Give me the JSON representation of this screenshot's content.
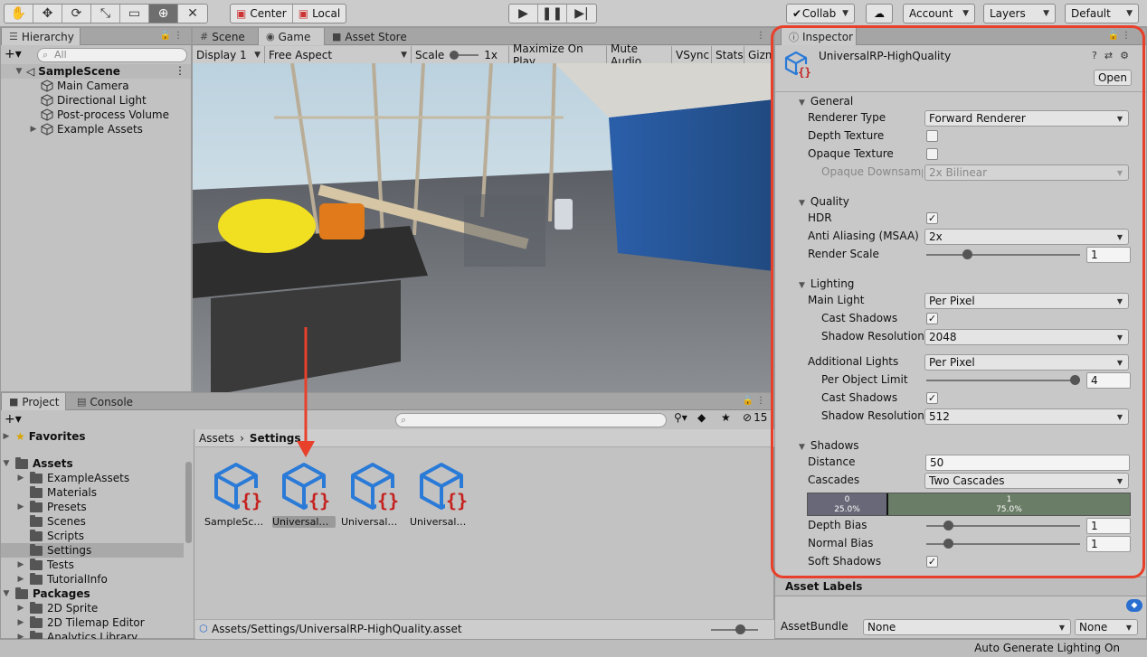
{
  "toolbar": {
    "tools": [
      "hand-icon",
      "move-icon",
      "rotate-icon",
      "scale-icon",
      "rect-icon",
      "transform-icon",
      "custom-tool-icon"
    ],
    "pivot_mode": "Center",
    "pivot_rotation": "Local",
    "collab": "Collab",
    "account": "Account",
    "layers": "Layers",
    "layout": "Default"
  },
  "hierarchy": {
    "tab_label": "Hierarchy",
    "search_placeholder": "All",
    "scene": "SampleScene",
    "items": [
      "Main Camera",
      "Directional Light",
      "Post-process Volume",
      "Example Assets"
    ]
  },
  "center_tabs": {
    "scene": "Scene",
    "game": "Game",
    "asset_store": "Asset Store"
  },
  "game_toolbar": {
    "display": "Display 1",
    "aspect": "Free Aspect",
    "scale_label": "Scale",
    "scale_value": "1x",
    "maximize": "Maximize On Play",
    "mute": "Mute Audio",
    "vsync": "VSync",
    "stats": "Stats",
    "gizmos": "Gizmos"
  },
  "project": {
    "tab_label": "Project",
    "console_label": "Console",
    "hidden_count": "15",
    "favorites": "Favorites",
    "assets_root": "Assets",
    "asset_folders": [
      "ExampleAssets",
      "Materials",
      "Presets",
      "Scenes",
      "Scripts",
      "Settings",
      "Tests",
      "TutorialInfo"
    ],
    "packages_root": "Packages",
    "package_folders": [
      "2D Sprite",
      "2D Tilemap Editor",
      "Analytics Library"
    ],
    "breadcrumb": [
      "Assets",
      "Settings"
    ],
    "asset_files": [
      "SampleSce...",
      "UniversalRP...",
      "UniversalRP...",
      "UniversalRP..."
    ],
    "status_path": "Assets/Settings/UniversalRP-HighQuality.asset"
  },
  "inspector": {
    "tab_label": "Inspector",
    "asset_name": "UniversalRP-HighQuality",
    "open_button": "Open",
    "general": {
      "title": "General",
      "renderer_type_label": "Renderer Type",
      "renderer_type": "Forward Renderer",
      "depth_texture_label": "Depth Texture",
      "depth_texture": false,
      "opaque_texture_label": "Opaque Texture",
      "opaque_texture": false,
      "opaque_downsampling_label": "Opaque Downsampli",
      "opaque_downsampling": "2x Bilinear"
    },
    "quality": {
      "title": "Quality",
      "hdr_label": "HDR",
      "hdr": true,
      "msaa_label": "Anti Aliasing (MSAA)",
      "msaa": "2x",
      "render_scale_label": "Render Scale",
      "render_scale": "1",
      "render_scale_fraction": 0.25
    },
    "lighting": {
      "title": "Lighting",
      "main_light_label": "Main Light",
      "main_light": "Per Pixel",
      "main_cast_shadows_label": "Cast Shadows",
      "main_cast_shadows": true,
      "main_shadow_res_label": "Shadow Resolution",
      "main_shadow_res": "2048",
      "additional_lights_label": "Additional Lights",
      "additional_lights": "Per Pixel",
      "per_object_limit_label": "Per Object Limit",
      "per_object_limit": "4",
      "per_object_limit_fraction": 1.0,
      "add_cast_shadows_label": "Cast Shadows",
      "add_cast_shadows": true,
      "add_shadow_res_label": "Shadow Resolution",
      "add_shadow_res": "512"
    },
    "shadows": {
      "title": "Shadows",
      "distance_label": "Distance",
      "distance": "50",
      "cascades_label": "Cascades",
      "cascades": "Two Cascades",
      "cascade_0_index": "0",
      "cascade_0_pct": "25.0%",
      "cascade_1_index": "1",
      "cascade_1_pct": "75.0%",
      "cascade_0_color": "#686878",
      "cascade_1_color": "#6a7d66",
      "depth_bias_label": "Depth Bias",
      "depth_bias": "1",
      "depth_bias_fraction": 0.12,
      "normal_bias_label": "Normal Bias",
      "normal_bias": "1",
      "normal_bias_fraction": 0.12,
      "soft_shadows_label": "Soft Shadows",
      "soft_shadows": true
    },
    "asset_labels": "Asset Labels",
    "asset_bundle_label": "AssetBundle",
    "asset_bundle": "None",
    "asset_bundle_variant": "None"
  },
  "status_bar": "Auto Generate Lighting On",
  "annotation_color": "#e8402a"
}
